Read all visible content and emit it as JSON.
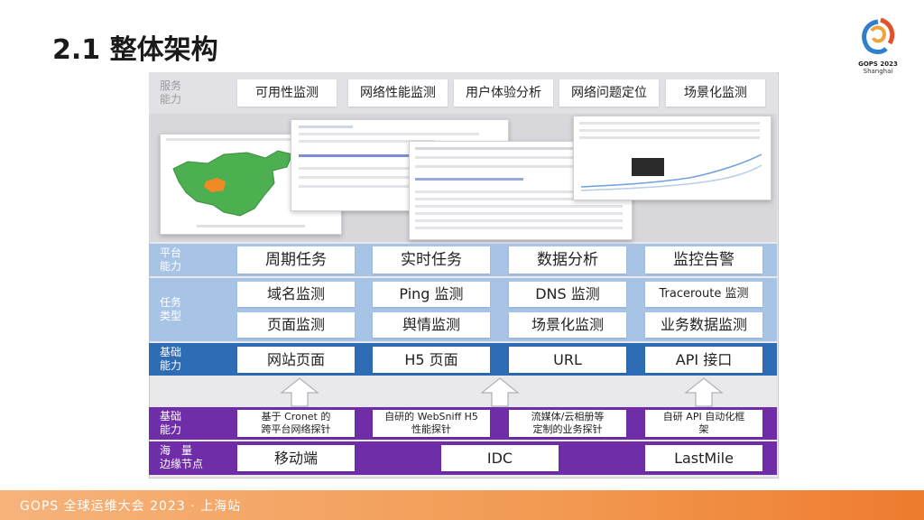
{
  "title": "2.1 整体架构",
  "logo": {
    "line1": "GOPS 2023",
    "line2": "Shanghai"
  },
  "service": {
    "label_line1": "服务",
    "label_line2": "能力",
    "items": [
      "可用性监测",
      "网络性能监测",
      "用户体验分析",
      "网络问题定位",
      "场景化监测"
    ]
  },
  "platform": {
    "label_line1": "平台",
    "label_line2": "能力",
    "items": [
      "周期任务",
      "实时任务",
      "数据分析",
      "监控告警"
    ]
  },
  "task_types": {
    "label_line1": "任务",
    "label_line2": "类型",
    "row1": [
      "域名监测",
      "Ping 监测",
      "DNS 监测",
      "Traceroute 监测"
    ],
    "row2": [
      "页面监测",
      "舆情监测",
      "场景化监测",
      "业务数据监测"
    ]
  },
  "base_top": {
    "label_line1": "基础",
    "label_line2": "能力",
    "items": [
      "网站页面",
      "H5 页面",
      "URL",
      "API 接口"
    ]
  },
  "base_bottom": {
    "label_line1": "基础",
    "label_line2": "能力",
    "items": [
      {
        "line1": "基于 Cronet 的",
        "line2": "跨平台网络探针"
      },
      {
        "line1": "自研的 WebSniff H5",
        "line2": "性能探针"
      },
      {
        "line1": "流媒体/云相册等",
        "line2": "定制的业务探针"
      },
      {
        "line1": "自研 API 自动化框",
        "line2": "架"
      }
    ]
  },
  "edge": {
    "label_line1": "海　量",
    "label_line2": "边缘节点",
    "items": [
      "移动端",
      "IDC",
      "LastMile"
    ]
  },
  "footer": "GOPS 全球运维大会 2023 · 上海站",
  "colors": {
    "service_band": "#e2e2e6",
    "platform_band": "#a7c4e6",
    "base_top_band": "#2e6cb5",
    "base_bottom_band": "#6f2da8",
    "footer": "#f29a52"
  }
}
